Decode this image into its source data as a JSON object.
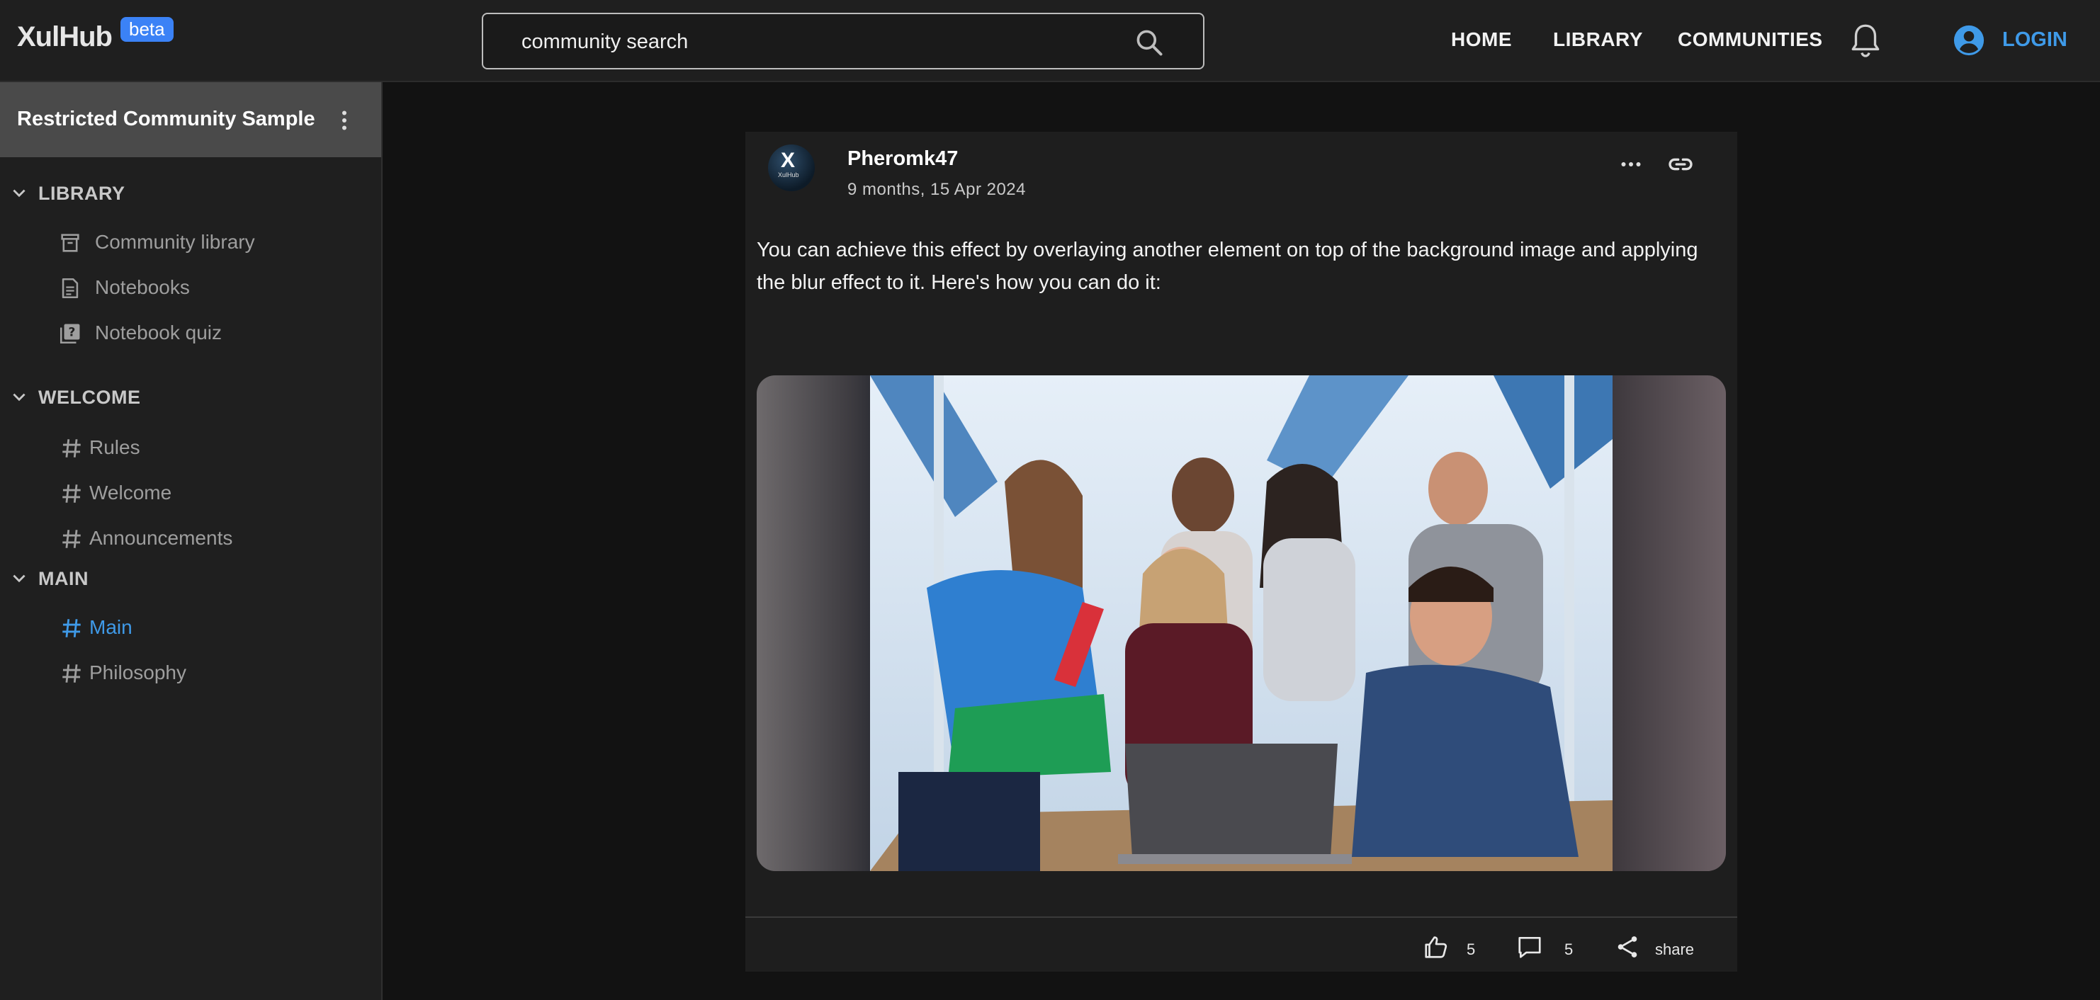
{
  "header": {
    "logo": "XulHub",
    "badge": "beta",
    "search_value": "community search",
    "nav": [
      "HOME",
      "LIBRARY",
      "COMMUNITIES"
    ],
    "login": "LOGIN"
  },
  "sidebar": {
    "community_title": "Restricted Community Sample",
    "sections": [
      {
        "title": "LIBRARY",
        "items": [
          "Community library",
          "Notebooks",
          "Notebook quiz"
        ]
      },
      {
        "title": "WELCOME",
        "items": [
          "Rules",
          "Welcome",
          "Announcements"
        ]
      },
      {
        "title": "MAIN",
        "items": [
          "Main",
          "Philosophy"
        ]
      }
    ],
    "active_item": "Main"
  },
  "post": {
    "avatar_text": "X",
    "avatar_subtext": "XulHub",
    "author": "Pheromk47",
    "date": "9 months, 15 Apr 2024",
    "body": "You can achieve this effect by overlaying another element on top of the background image and applying the blur effect to it. Here's how you can do it:",
    "likes": "5",
    "comments": "5",
    "share": "share"
  },
  "colors": {
    "accent": "#3f9ae8",
    "badge": "#3b82f6",
    "background": "#121212",
    "panel": "#1f1f1f"
  }
}
